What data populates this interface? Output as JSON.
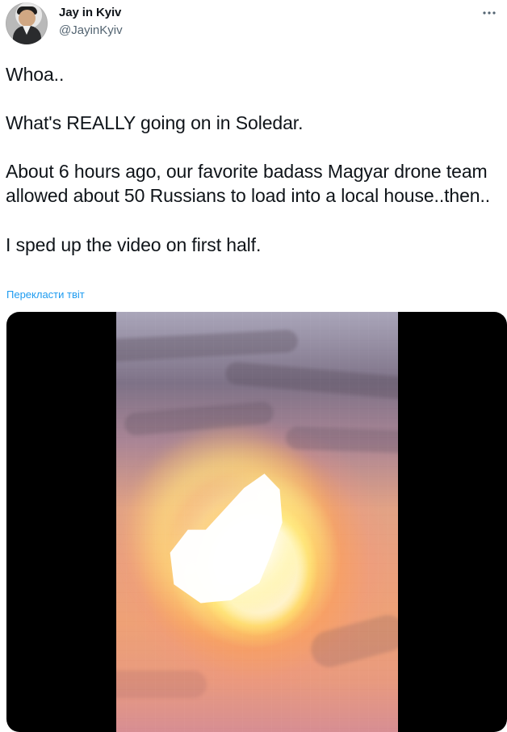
{
  "author": {
    "display_name": "Jay in Kyiv",
    "handle": "@JayinKyiv",
    "avatar_icon": "user-avatar"
  },
  "actions": {
    "more_icon": "more-horizontal-icon"
  },
  "tweet": {
    "paragraphs": [
      "Whoa..",
      "What's REALLY going on in Soledar.",
      "About 6 hours ago, our favorite badass Magyar drone team allowed about 50 Russians to load into a local house..then..",
      "I sped up the video on first half."
    ],
    "translate_label": "Перекласти твіт"
  },
  "media": {
    "type": "video-preview",
    "description_icon": "explosion-video"
  },
  "colors": {
    "text": "#0f1419",
    "secondary_text": "#536471",
    "link": "#1d9bf0",
    "video_background": "#000000"
  }
}
